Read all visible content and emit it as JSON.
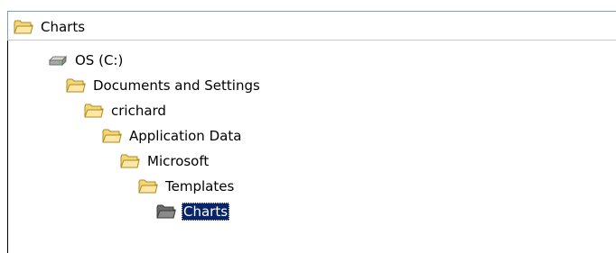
{
  "combo": {
    "label": "Charts",
    "icon": "folder-open-icon"
  },
  "tree": {
    "items": [
      {
        "label": "OS (C:)",
        "icon": "hard-drive-icon",
        "depth": 0,
        "selected": false
      },
      {
        "label": "Documents and Settings",
        "icon": "folder-open-icon",
        "depth": 1,
        "selected": false
      },
      {
        "label": "crichard",
        "icon": "folder-open-icon",
        "depth": 2,
        "selected": false
      },
      {
        "label": "Application Data",
        "icon": "folder-open-icon",
        "depth": 3,
        "selected": false
      },
      {
        "label": "Microsoft",
        "icon": "folder-open-icon",
        "depth": 4,
        "selected": false
      },
      {
        "label": "Templates",
        "icon": "folder-open-icon",
        "depth": 5,
        "selected": false
      },
      {
        "label": "Charts",
        "icon": "folder-open-icon",
        "depth": 6,
        "selected": true
      }
    ]
  },
  "colors": {
    "selection_bg": "#0a246a",
    "folder_fill": "#f3d57a",
    "folder_selected_fill": "#6b6b6b",
    "border": "#7f9db9"
  }
}
